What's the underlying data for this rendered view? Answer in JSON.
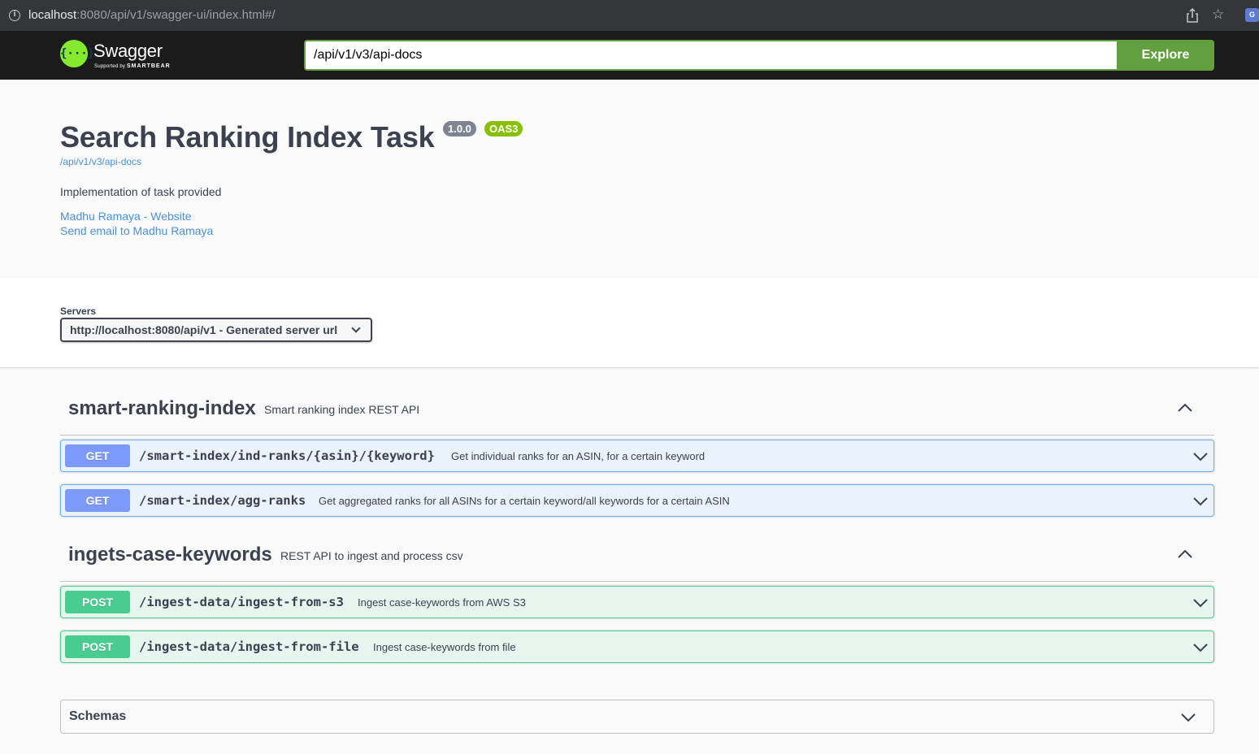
{
  "browser": {
    "url_host": "localhost",
    "url_rest": ":8080/api/v1/swagger-ui/index.html#/",
    "info_icon": "info-icon",
    "share_icon": "share-icon",
    "star_icon": "bookmark-star-icon",
    "extension_icon": "google-translate-extension-icon"
  },
  "topbar": {
    "logo_icon": "swagger-logo-icon",
    "logo_mark": "{···}",
    "logo_text": "Swagger",
    "logo_sub_prefix": "Supported by",
    "logo_sub_brand": "SMARTBEAR",
    "spec_url_value": "/api/v1/v3/api-docs",
    "explore_label": "Explore",
    "accent_color": "#62a03f"
  },
  "info": {
    "title": "Search Ranking Index Task",
    "version_badge": "1.0.0",
    "oas_badge": "OAS3",
    "spec_link": "/api/v1/v3/api-docs",
    "description": "Implementation of task provided",
    "contact_website": "Madhu Ramaya - Website",
    "contact_email": "Send email to Madhu Ramaya"
  },
  "servers": {
    "label": "Servers",
    "selected": "http://localhost:8080/api/v1 - Generated server url"
  },
  "tags": [
    {
      "name": "smart-ranking-index",
      "description": "Smart ranking index REST API",
      "expanded": true,
      "operations": [
        {
          "method": "GET",
          "path": "/smart-index/ind-ranks/{asin}/{keyword}",
          "summary": "Get individual ranks for an ASIN, for a certain keyword"
        },
        {
          "method": "GET",
          "path": "/smart-index/agg-ranks",
          "summary": "Get aggregated ranks for all ASINs for a certain keyword/all keywords for a certain ASIN"
        }
      ]
    },
    {
      "name": "ingets-case-keywords",
      "description": "REST API to ingest and process csv",
      "expanded": true,
      "operations": [
        {
          "method": "POST",
          "path": "/ingest-data/ingest-from-s3",
          "summary": "Ingest case-keywords from AWS S3"
        },
        {
          "method": "POST",
          "path": "/ingest-data/ingest-from-file",
          "summary": "Ingest case-keywords from file"
        }
      ]
    }
  ],
  "schemas": {
    "title": "Schemas"
  },
  "colors": {
    "get": "#61affe",
    "post": "#49cc90",
    "link": "#4990e2"
  }
}
